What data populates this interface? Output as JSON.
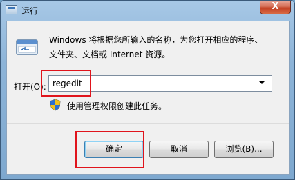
{
  "window": {
    "title": "运行",
    "close_label": "X"
  },
  "dialog": {
    "description_line1": "Windows 将根据您所输入的名称，为您打开相应的程序、",
    "description_line2": "文件夹、文档或 Internet 资源。",
    "open_label": "打开(O):",
    "input_value": "regedit",
    "admin_note": "使用管理权限创建此任务。"
  },
  "buttons": {
    "ok": "确定",
    "cancel": "取消",
    "browse": "浏览(B)..."
  },
  "icons": {
    "title": "run-icon",
    "dialog": "run-program-icon",
    "shield": "uac-shield-icon",
    "dropdown": "chevron-down-icon"
  },
  "colors": {
    "highlight": "#e0141c",
    "close_button": "#c34024",
    "titlebar": "#8db4d8",
    "client_bg": "#f0f0f0"
  }
}
